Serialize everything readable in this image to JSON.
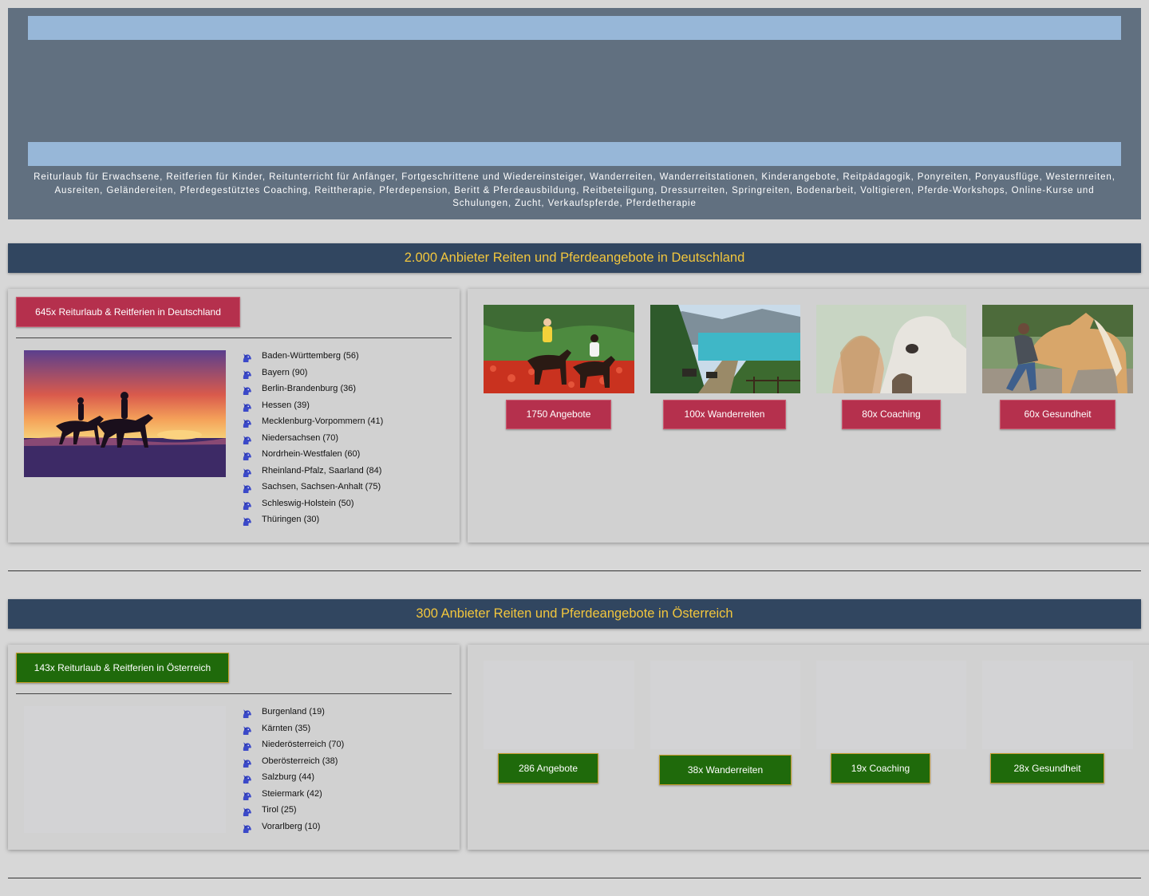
{
  "header": {
    "keywords": "Reiturlaub für Erwachsene, Reitferien für Kinder, Reitunterricht für Anfänger, Fortgeschrittene und Wiedereinsteiger, Wanderreiten, Wanderreitstationen,  Kinderangebote,  Reitpädagogik, Ponyreiten, Ponyausflüge, Westernreiten, Ausreiten,  Geländereiten, Pferdegestütztes Coaching, Reittherapie, Pferdepension,  Beritt & Pferdeausbildung,  Reitbeteiligung, Dressurreiten, Springreiten, Bodenarbeit, Voltigieren, Pferde-Workshops, Online-Kurse und Schulungen, Zucht, Verkaufspferde, Pferdetherapie"
  },
  "germany": {
    "title": "2.000 Anbieter Reiten und Pferdeangebote in Deutschland",
    "main_button": "645x Reiturlaub & Reitferien in Deutschland",
    "regions": [
      "Baden-Württemberg (56)",
      "Bayern (90)",
      "Berlin-Brandenburg (36)",
      "Hessen (39)",
      "Mecklenburg-Vorpommern (41)",
      "Niedersachsen (70)",
      "Nordrhein-Westfalen (60)",
      "Rheinland-Pfalz, Saarland (84)",
      "Sachsen, Sachsen-Anhalt (75)",
      "Schleswig-Holstein (50)",
      "Thüringen (30)"
    ],
    "offers": [
      "1750 Angebote",
      "100x  Wanderreiten",
      "80x Coaching",
      "60x  Gesundheit"
    ]
  },
  "austria": {
    "title": "300 Anbieter Reiten und Pferdeangebote in Österreich",
    "main_button": "143x Reiturlaub & Reitferien in Österreich",
    "regions": [
      "Burgenland (19)",
      "Kärnten (35)",
      "Niederösterreich (70)",
      "Oberösterreich (38)",
      "Salzburg (44)",
      "Steiermark (42)",
      "Tirol (25)",
      "Vorarlberg (10)"
    ],
    "offers": [
      "286 Angebote",
      "38x Wanderreiten",
      "19x Coaching",
      "28x Gesundheit"
    ]
  },
  "colors": {
    "page_bg": "#d7d7d7",
    "header_bg": "#617080",
    "header_bar": "#97b7d8",
    "title_bar": "#314660",
    "title_text": "#f2c63d",
    "button_red": "#b5304d",
    "button_green": "#1f6a0b",
    "horse_icon": "#3b49c8"
  },
  "icons": {
    "list_bullet": "horse-head-icon"
  }
}
